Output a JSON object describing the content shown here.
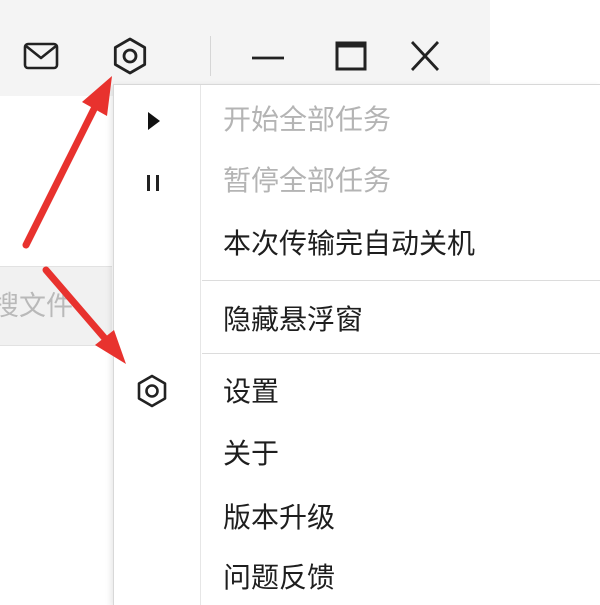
{
  "titlebar": {
    "icons": [
      "mail-icon",
      "settings-icon",
      "minimize-icon",
      "maximize-icon",
      "close-icon"
    ]
  },
  "background": {
    "search_fragment": "搜文件"
  },
  "menu": {
    "items": [
      {
        "label": "开始全部任务",
        "icon": "play-icon",
        "disabled": true
      },
      {
        "label": "暂停全部任务",
        "icon": "pause-icon",
        "disabled": true
      },
      {
        "label": "本次传输完自动关机",
        "disabled": false
      },
      {
        "label": "隐藏悬浮窗",
        "disabled": false
      },
      {
        "label": "设置",
        "icon": "settings-icon",
        "disabled": false
      },
      {
        "label": "关于",
        "disabled": false
      },
      {
        "label": "版本升级",
        "disabled": false
      },
      {
        "label": "问题反馈",
        "disabled": false
      }
    ]
  },
  "annotation": {
    "arrow_color": "#e8322e"
  },
  "colors": {
    "menu_text": "#1e1e1e",
    "menu_disabled": "#b4b4b4",
    "titlebar_bg": "#f4f4f4"
  }
}
